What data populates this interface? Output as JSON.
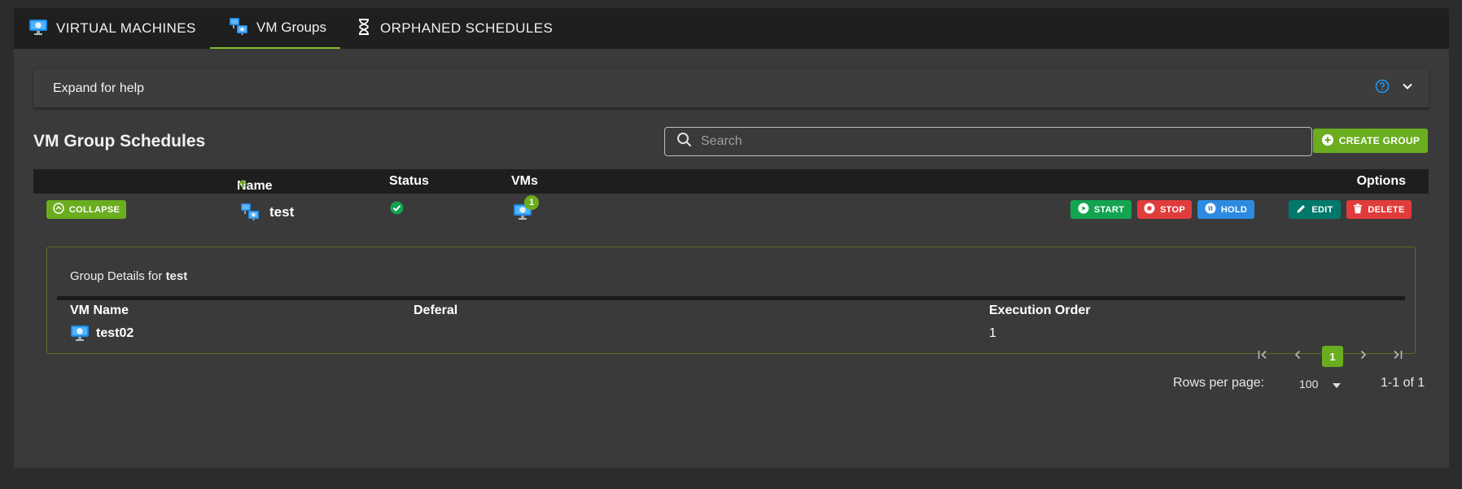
{
  "tabs": [
    {
      "label": "VIRTUAL MACHINES",
      "icon": "monitor-icon"
    },
    {
      "label": "VM Groups",
      "icon": "vm-group-icon",
      "active": true
    },
    {
      "label": "ORPHANED SCHEDULES",
      "icon": "hourglass-icon"
    }
  ],
  "help": {
    "label": "Expand for help"
  },
  "page_title": "VM Group Schedules",
  "search": {
    "placeholder": "Search",
    "value": ""
  },
  "create_button": "CREATE GROUP",
  "table": {
    "columns": {
      "name": "Name",
      "status": "Status",
      "vms": "VMs",
      "options": "Options"
    },
    "rows": [
      {
        "collapse_label": "COLLAPSE",
        "name": "test",
        "status": "ok",
        "vm_count": "1",
        "actions": {
          "start": "START",
          "stop": "STOP",
          "hold": "HOLD",
          "edit": "EDIT",
          "delete": "DELETE"
        }
      }
    ]
  },
  "details": {
    "caption_prefix": "Group Details for",
    "group_name": "test",
    "columns": {
      "vm_name": "VM Name",
      "deferal": "Deferal",
      "execution_order": "Execution Order"
    },
    "rows": [
      {
        "vm_name": "test02",
        "deferal": "",
        "execution_order": "1"
      }
    ]
  },
  "pagination": {
    "current_page": "1",
    "rows_per_page_label": "Rows per page:",
    "rows_per_page": "100",
    "range": "1-1 of 1"
  },
  "colors": {
    "accent": "#6aad1f",
    "start": "#13a451",
    "stop": "#e03c3c",
    "hold": "#2c8be0",
    "edit": "#00796b",
    "help_icon": "#2196f3"
  }
}
